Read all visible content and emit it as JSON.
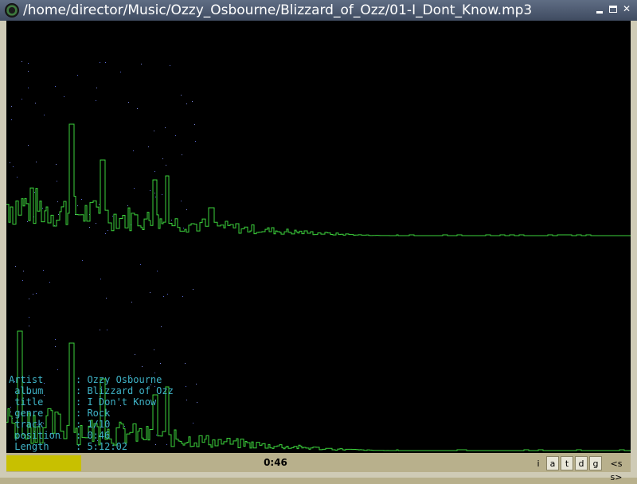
{
  "window": {
    "title": "/home/director/Music/Ozzy_Osbourne/Blizzard_of_Ozz/01-I_Dont_Know.mp3",
    "buttons": {
      "minimize": "minimize-icon",
      "maximize": "maximize-icon",
      "close": "close-icon"
    }
  },
  "track_info": [
    {
      "key": "Artist",
      "value": ": Ozzy Osbourne"
    },
    {
      "key": " album",
      "value": ": Blizzard of Ozz"
    },
    {
      "key": " title",
      "value": ": I Don't Know"
    },
    {
      "key": " genre",
      "value": ": Rock"
    },
    {
      "key": " track",
      "value": ": 1/10"
    },
    {
      "key": " position",
      "value": ": 0:46"
    },
    {
      "key": " Length",
      "value": ": 5:12:02"
    }
  ],
  "status": {
    "time": "0:46",
    "progress": 0.12,
    "modes": [
      {
        "label": "i",
        "active": false
      },
      {
        "label": "a",
        "active": true
      },
      {
        "label": "t",
        "active": true
      },
      {
        "label": "d",
        "active": true
      },
      {
        "label": "g",
        "active": true
      },
      {
        "label": "<s s>",
        "active": false
      }
    ]
  },
  "colors": {
    "spectrum_line": "#3cd23c",
    "peak_dots": "#5a6bd8",
    "info_text": "#3fb4c8",
    "progress_fill": "#c8c000",
    "background": "#000000"
  }
}
